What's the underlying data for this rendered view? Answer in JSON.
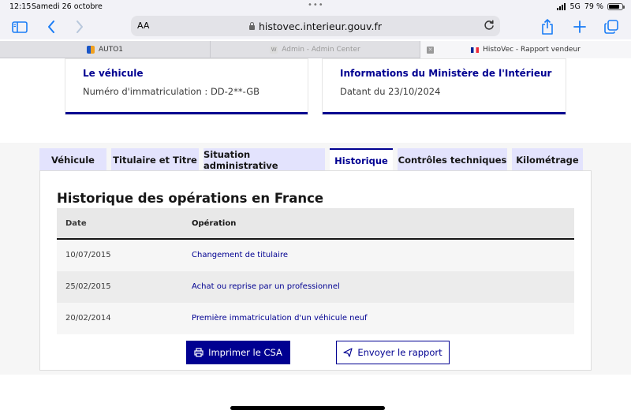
{
  "status_bar": {
    "time": "12:15",
    "date": "Samedi 26 octobre",
    "network": "5G",
    "battery": "79 %"
  },
  "toolbar": {
    "text_size_label": "AA",
    "url": "histovec.interieur.gouv.fr"
  },
  "browser_tabs": [
    {
      "label": "AUTO1"
    },
    {
      "label": "Admin - Admin Center"
    },
    {
      "label": "HistoVec - Rapport vendeur"
    }
  ],
  "cards": [
    {
      "title": "Le véhicule",
      "text": "Numéro d'immatriculation : DD-2**-GB"
    },
    {
      "title": "Informations du Ministère de l'Intérieur",
      "text": "Datant du 23/10/2024"
    }
  ],
  "tabs": [
    {
      "label": "Véhicule"
    },
    {
      "label": "Titulaire et Titre"
    },
    {
      "label": "Situation administrative"
    },
    {
      "label": "Historique"
    },
    {
      "label": "Contrôles techniques"
    },
    {
      "label": "Kilométrage"
    }
  ],
  "active_tab": "Historique",
  "history": {
    "title": "Historique des opérations en France",
    "columns": [
      "Date",
      "Opération"
    ],
    "rows": [
      {
        "date": "10/07/2015",
        "operation": "Changement de titulaire"
      },
      {
        "date": "25/02/2015",
        "operation": "Achat ou reprise par un professionnel"
      },
      {
        "date": "20/02/2014",
        "operation": "Première immatriculation d'un véhicule neuf"
      }
    ]
  },
  "actions": {
    "print_label": "Imprimer le CSA",
    "send_label": "Envoyer le rapport"
  },
  "colors": {
    "primary": "#000091",
    "tab_inactive": "#e3e3fd"
  }
}
